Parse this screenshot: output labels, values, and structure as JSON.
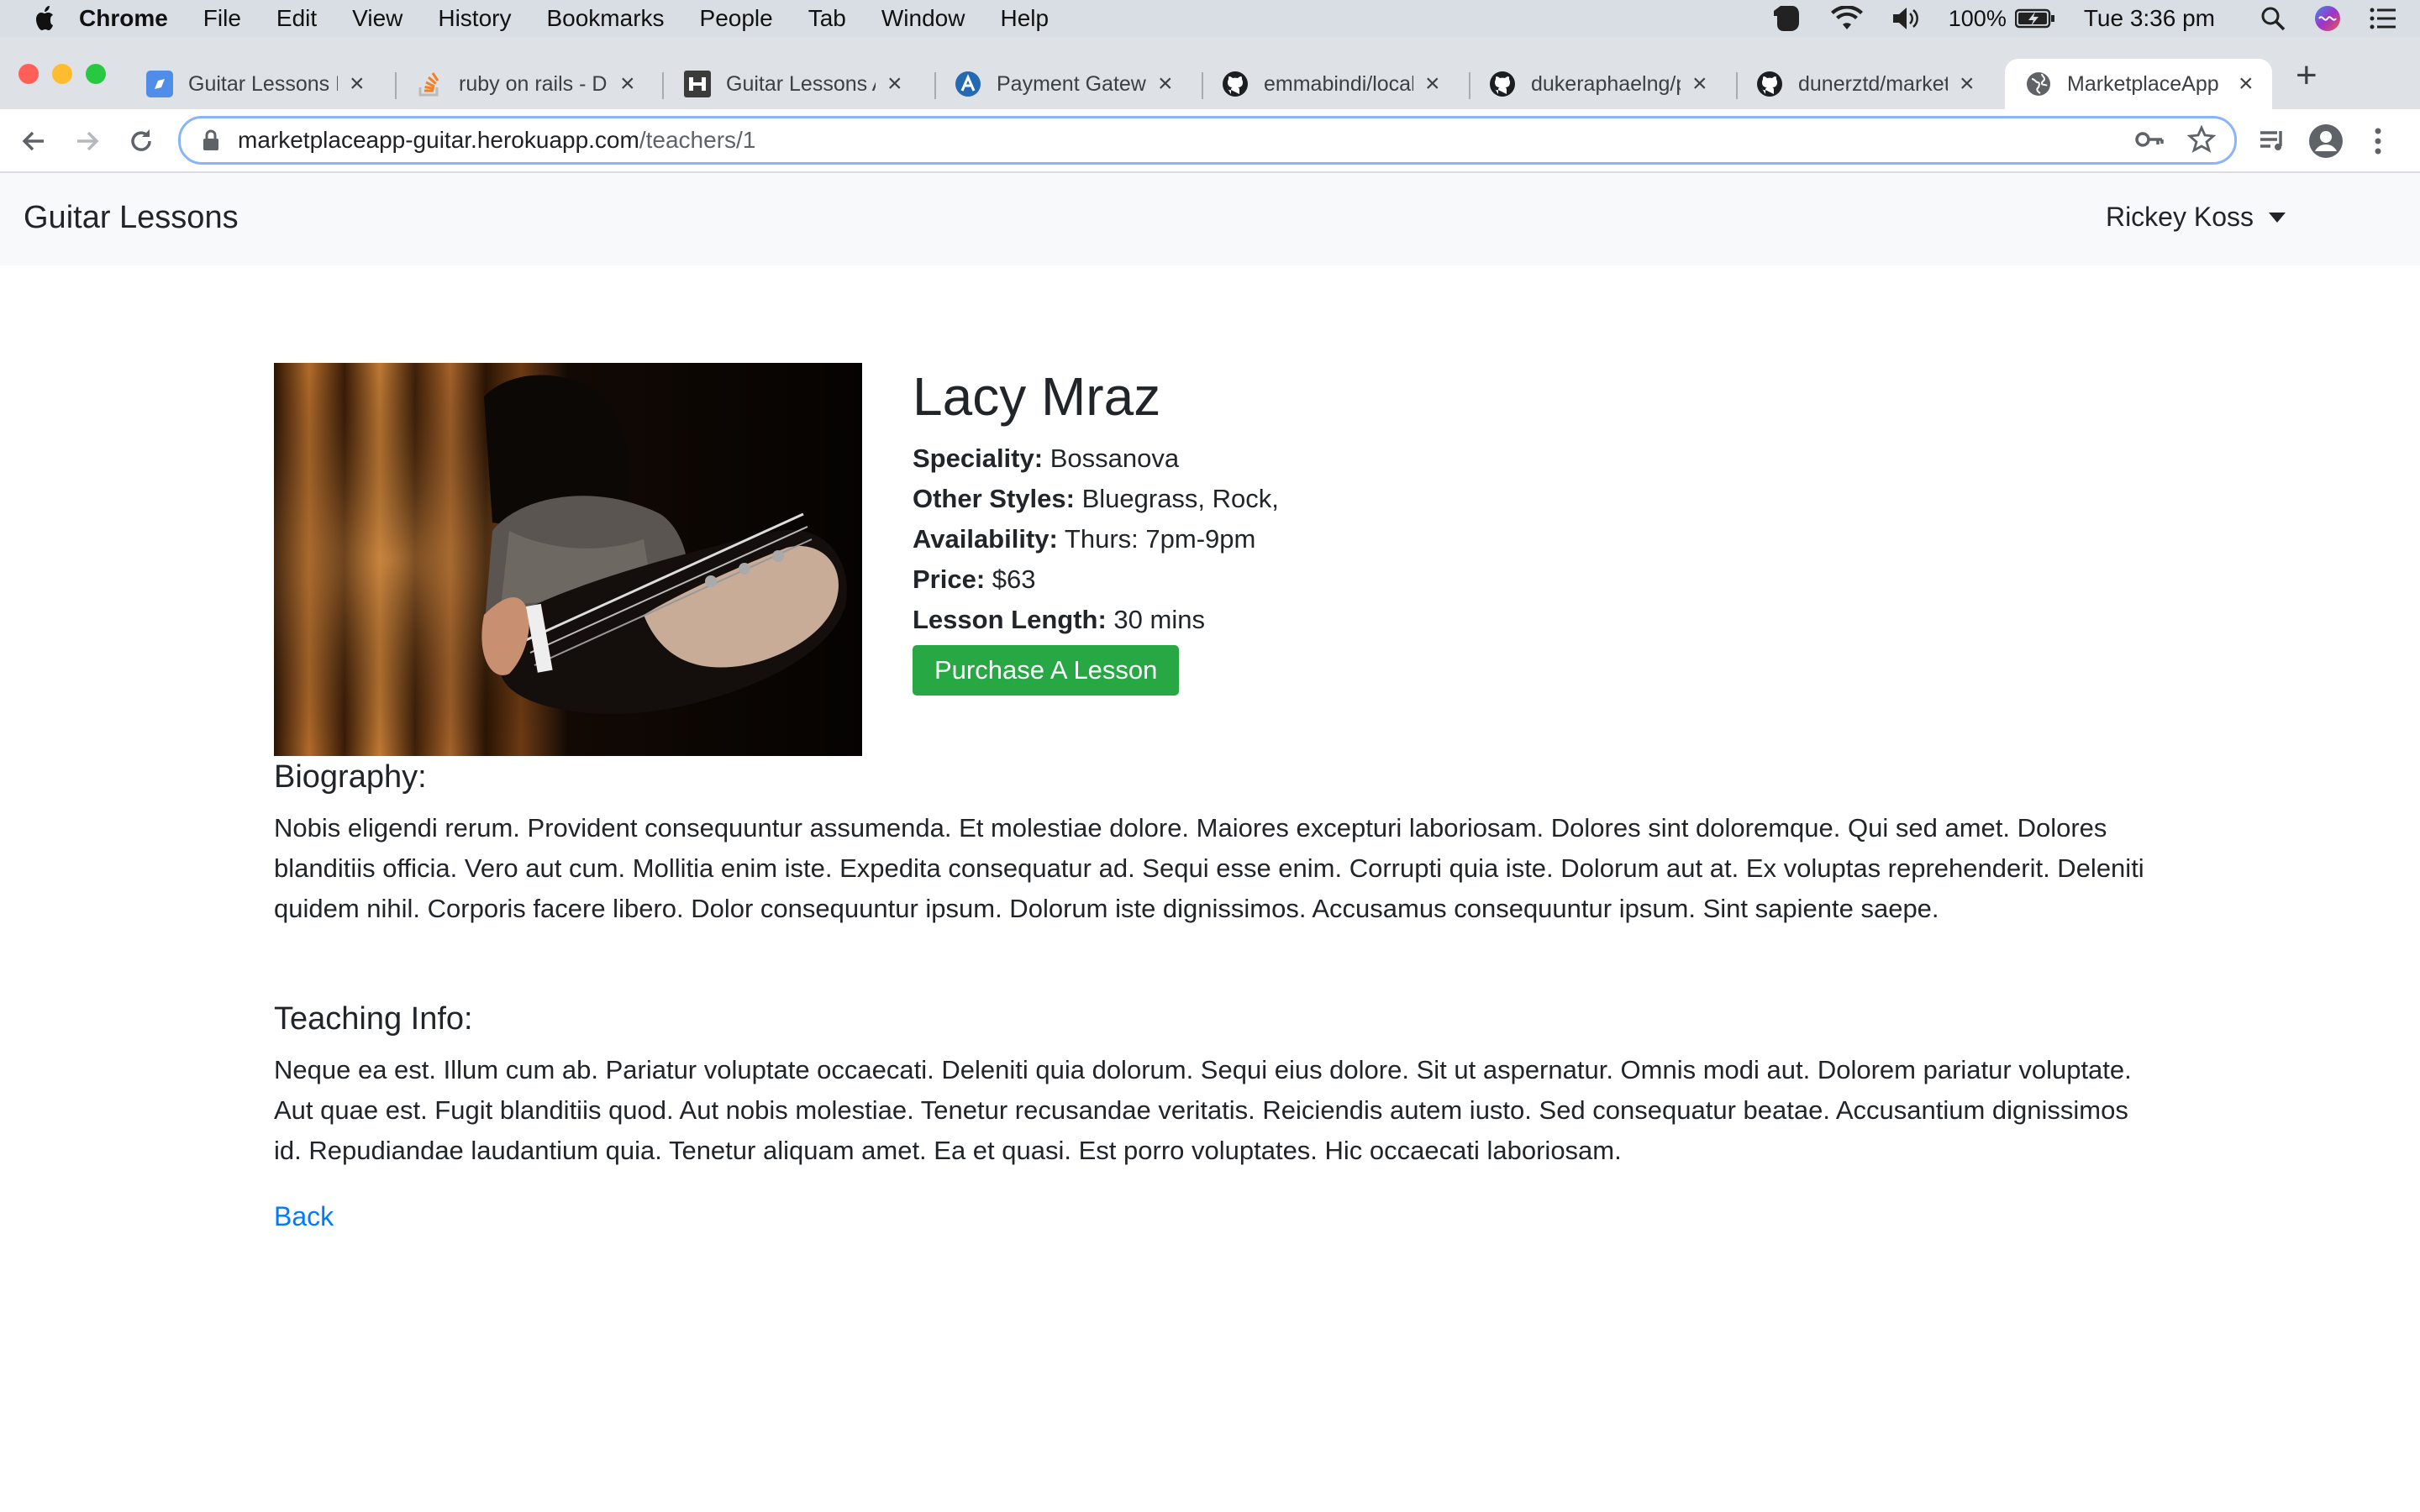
{
  "menubar": {
    "app": "Chrome",
    "items": [
      "File",
      "Edit",
      "View",
      "History",
      "Bookmarks",
      "People",
      "Tab",
      "Window",
      "Help"
    ],
    "battery": "100%",
    "clock": "Tue 3:36 pm"
  },
  "tabs": [
    {
      "title": "Guitar Lessons M",
      "active": false
    },
    {
      "title": "ruby on rails - Di",
      "active": false
    },
    {
      "title": "Guitar Lessons A",
      "active": false
    },
    {
      "title": "Payment Gatewa",
      "active": false
    },
    {
      "title": "emmabindi/local",
      "active": false
    },
    {
      "title": "dukeraphaelng/p",
      "active": false
    },
    {
      "title": "dunerztd/market",
      "active": false
    },
    {
      "title": "MarketplaceApp",
      "active": true
    }
  ],
  "address": {
    "host": "marketplaceapp-guitar.herokuapp.com",
    "path": "/teachers/1"
  },
  "app": {
    "brand": "Guitar Lessons",
    "user": "Rickey Koss"
  },
  "teacher": {
    "name": "Lacy Mraz",
    "speciality_label": "Speciality:",
    "speciality": "Bossanova",
    "styles_label": "Other Styles:",
    "styles": "Bluegrass, Rock,",
    "availability_label": "Availability:",
    "availability": "Thurs: 7pm-9pm",
    "price_label": "Price:",
    "price": "$63",
    "length_label": "Lesson Length:",
    "length": "30 mins",
    "purchase_button": "Purchase A Lesson",
    "bio_heading": "Biography:",
    "bio": "Nobis eligendi rerum. Provident consequuntur assumenda. Et molestiae dolore. Maiores excepturi laboriosam. Dolores sint doloremque. Qui sed amet. Dolores blanditiis officia. Vero aut cum. Mollitia enim iste. Expedita consequatur ad. Sequi esse enim. Corrupti quia iste. Dolorum aut at. Ex voluptas reprehenderit. Deleniti quidem nihil. Corporis facere libero. Dolor consequuntur ipsum. Dolorum iste dignissimos. Accusamus consequuntur ipsum. Sint sapiente saepe.",
    "teaching_heading": "Teaching Info:",
    "teaching": "Neque ea est. Illum cum ab. Pariatur voluptate occaecati. Deleniti quia dolorum. Sequi eius dolore. Sit ut aspernatur. Omnis modi aut. Dolorem pariatur voluptate. Aut quae est. Fugit blanditiis quod. Aut nobis molestiae. Tenetur recusandae veritatis. Reiciendis autem iusto. Sed consequatur beatae. Accusantium dignissimos id. Repudiandae laudantium quia. Tenetur aliquam amet. Ea et quasi. Est porro voluptates. Hic occaecati laboriosam.",
    "back_link": "Back"
  },
  "colors": {
    "primary_button": "#28a745",
    "link": "#007bff",
    "navbar_bg": "#f8f9fa",
    "omnibox_focus": "#8ab4f8"
  }
}
